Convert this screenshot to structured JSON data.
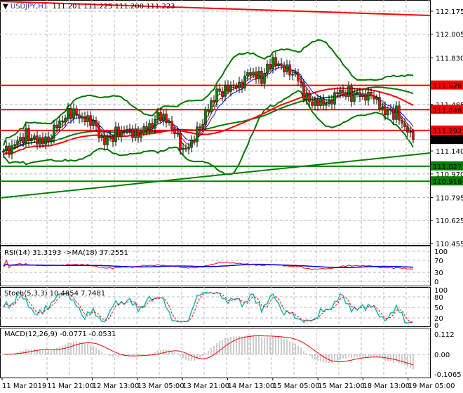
{
  "header": {
    "symbol": "USDJPY,H1",
    "open": "111.201",
    "high": "111.225",
    "low": "111.200",
    "close": "111.223"
  },
  "indicators": {
    "rsi_label": "RSI(14) 31.3193  ->MA(18) 37.2551",
    "stoch_label": "Stoch(5,3,3) 10.4854 7.7481",
    "macd_label": "MACD(12,26,9) -0.0771 -0.0531"
  },
  "colors": {
    "bull": "#008000",
    "bear": "#ff0000",
    "bands": "#007700",
    "resistance": "#ff0000",
    "support": "#008000",
    "rsi": "#ff0000",
    "rsi_ma": "#0000ff",
    "stoch_main": "#20b2aa",
    "stoch_signal": "#ff0000"
  },
  "chart_data": {
    "type": "candlestick",
    "title": "USDJPY,H1",
    "ylim": [
      110.455,
      112.175
    ],
    "y_ticks": [
      "112.175",
      "112.005",
      "111.830",
      "111.485",
      "111.140",
      "110.970",
      "110.795",
      "110.625",
      "110.455"
    ],
    "x_ticks": [
      "11 Mar 2019",
      "11 Mar 21:00",
      "12 Mar 13:00",
      "13 Mar 05:00",
      "13 Mar 21:00",
      "14 Mar 13:00",
      "15 Mar 05:00",
      "15 Mar 21:00",
      "18 Mar 13:00",
      "19 Mar 05:00"
    ],
    "approx_closes_every_4_bars": [
      111.12,
      111.2,
      111.27,
      111.22,
      111.24,
      111.35,
      111.42,
      111.38,
      111.33,
      111.2,
      111.28,
      111.3,
      111.28,
      111.33,
      111.4,
      111.32,
      111.12,
      111.22,
      111.42,
      111.57,
      111.62,
      111.64,
      111.72,
      111.68,
      111.8,
      111.73,
      111.71,
      111.52,
      111.5,
      111.52,
      111.59,
      111.56,
      111.55,
      111.52,
      111.42,
      111.42,
      111.28,
      111.223
    ],
    "resistance_levels": [
      {
        "label": "111.626",
        "value": 111.626
      },
      {
        "label": "111.446",
        "value": 111.446
      },
      {
        "label": "111.292",
        "value": 111.292
      }
    ],
    "support_levels": [
      {
        "label": "111.027",
        "value": 111.027
      },
      {
        "label": "110.916",
        "value": 110.916
      }
    ],
    "current_price": {
      "label": "111.223",
      "value": 111.223
    },
    "rsi_ticks": [
      "100",
      "70",
      "30",
      "0"
    ],
    "stoch_ticks": [
      "100",
      "80",
      "50",
      "20",
      "0"
    ],
    "macd_ticks": [
      "0.112",
      "0.00",
      "-0.1065"
    ]
  }
}
